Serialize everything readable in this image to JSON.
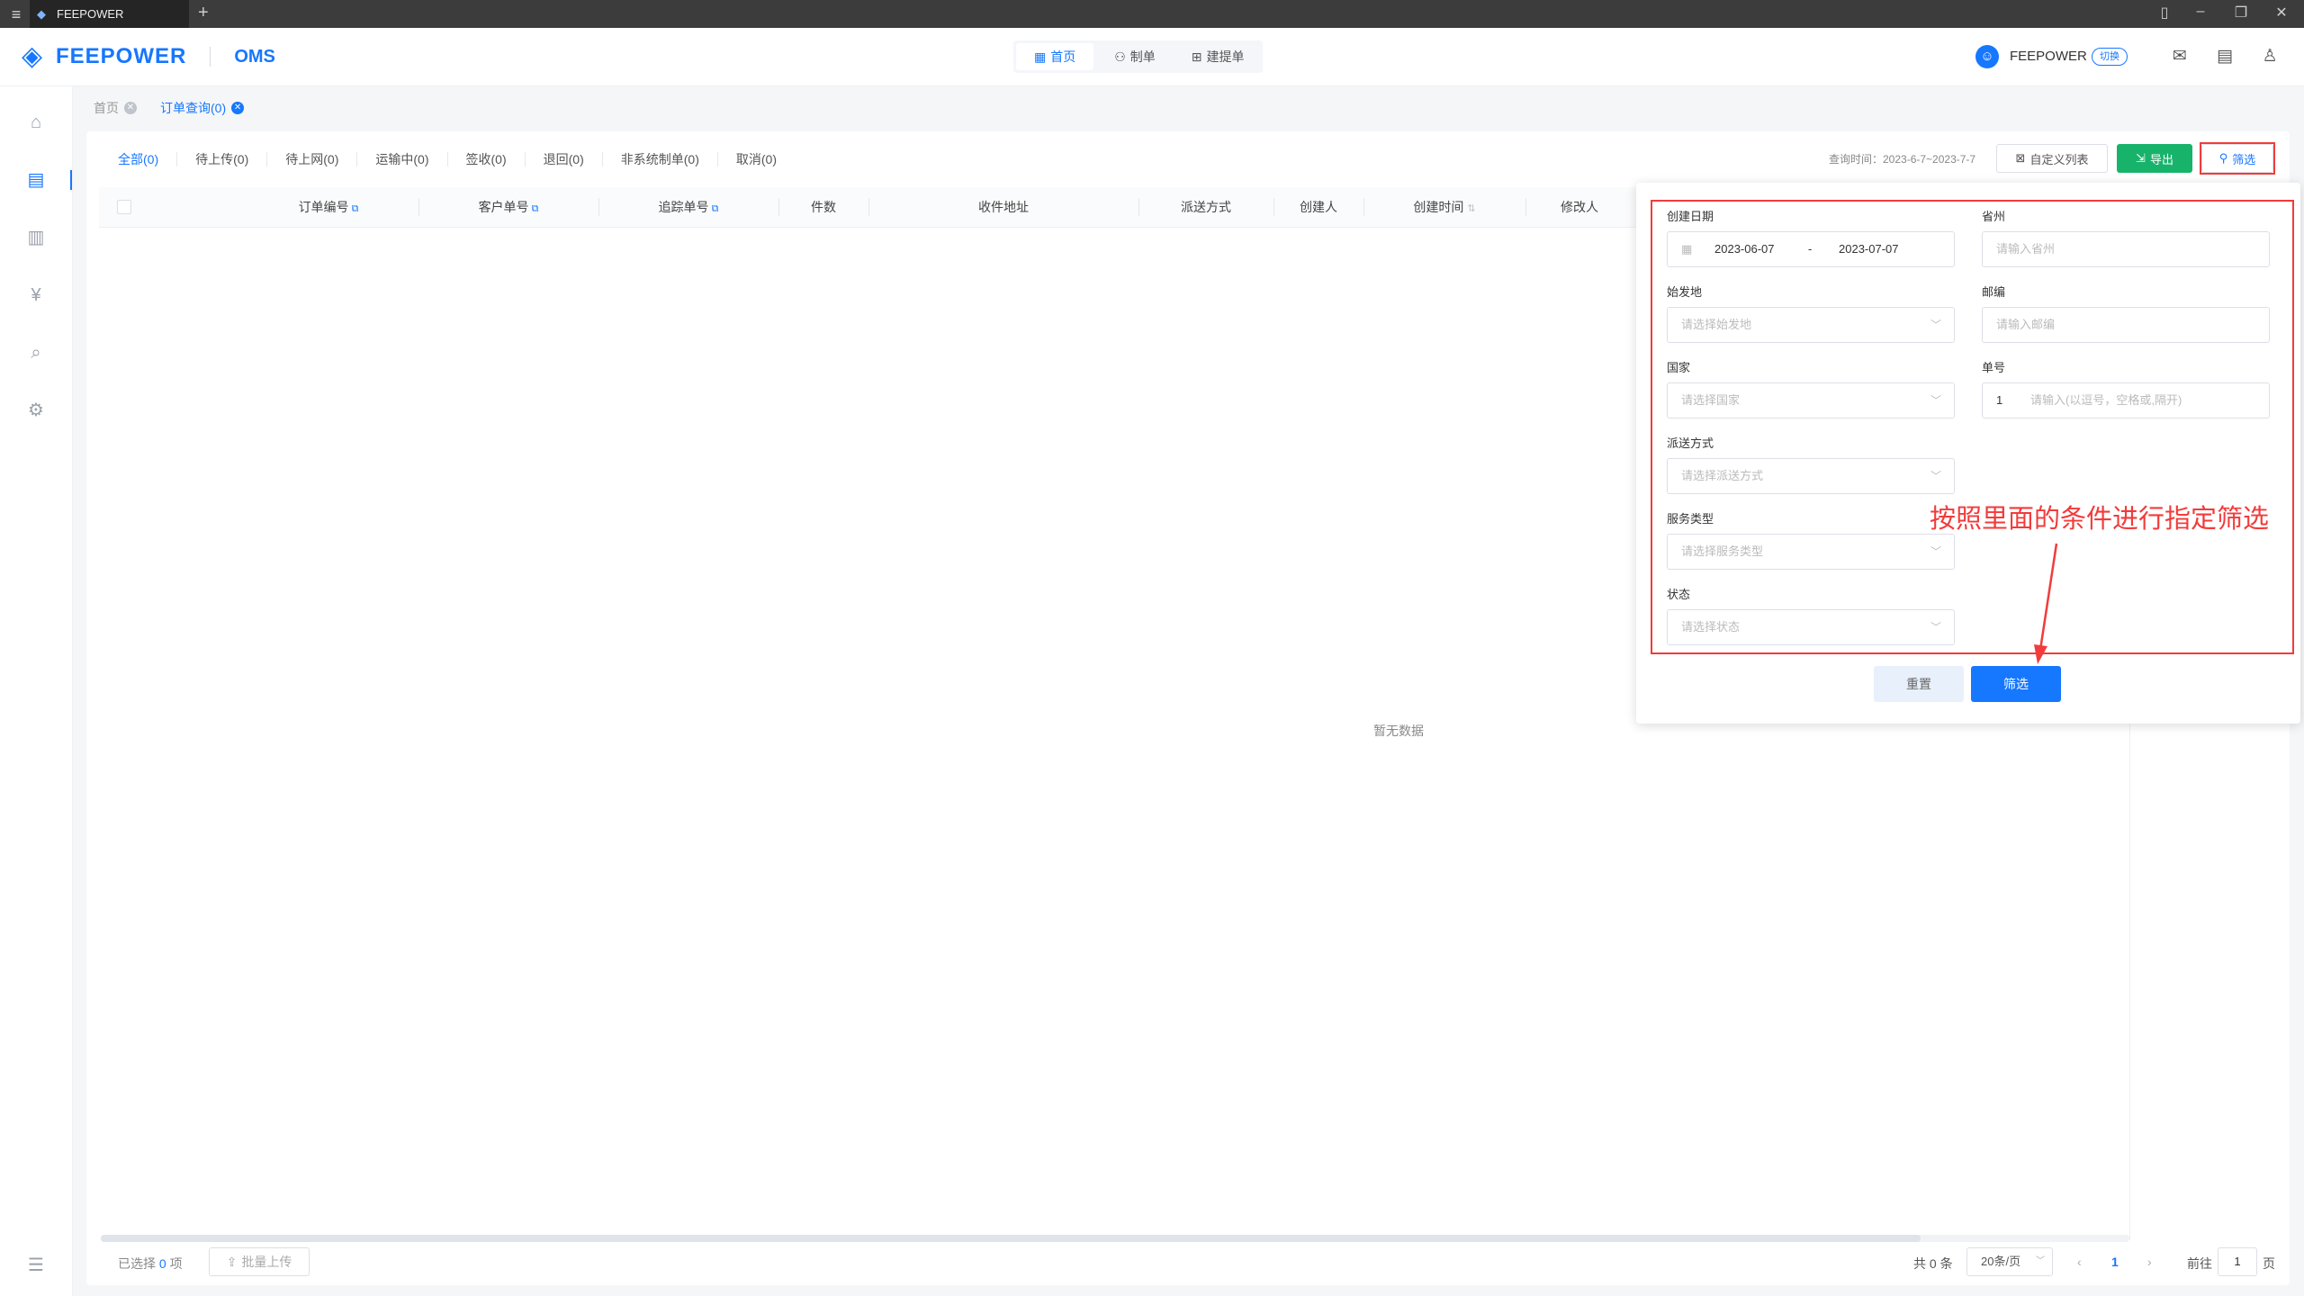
{
  "window": {
    "tab_title": "FEEPOWER"
  },
  "header": {
    "brand": "FEEPOWER",
    "product": "OMS",
    "nav": [
      "首页",
      "制单",
      "建提单"
    ],
    "user_name": "FEEPOWER",
    "switch_label": "切换"
  },
  "breadcrumb": [
    "首页",
    "订单查询(0)"
  ],
  "status_tabs": [
    "全部(0)",
    "待上传(0)",
    "待上网(0)",
    "运输中(0)",
    "签收(0)",
    "退回(0)",
    "非系统制单(0)",
    "取消(0)"
  ],
  "toolbar": {
    "query_time": "查询时间：2023-6-7~2023-7-7",
    "custom_columns": "自定义列表",
    "export": "导出",
    "filter": "筛选"
  },
  "table": {
    "columns": [
      "订单编号",
      "客户单号",
      "追踪单号",
      "件数",
      "收件地址",
      "派送方式",
      "创建人",
      "创建时间",
      "修改人"
    ],
    "empty_text": "暂无数据"
  },
  "footer": {
    "selected_prefix": "已选择",
    "selected_count": "0",
    "selected_suffix": "项",
    "batch_upload": "批量上传",
    "total": "共 0 条",
    "page_size": "20条/页",
    "current_page": "1",
    "goto_label": "前往",
    "goto_value": "1",
    "page_suffix": "页"
  },
  "filter_panel": {
    "create_date_label": "创建日期",
    "date_start": "2023-06-07",
    "date_sep": "-",
    "date_end": "2023-07-07",
    "province_label": "省州",
    "province_placeholder": "请输入省州",
    "origin_label": "始发地",
    "origin_placeholder": "请选择始发地",
    "zip_label": "邮编",
    "zip_placeholder": "请输入邮编",
    "country_label": "国家",
    "country_placeholder": "请选择国家",
    "number_label": "单号",
    "number_value": "1",
    "number_placeholder": "请输入(以逗号，空格或,隔开)",
    "delivery_label": "派送方式",
    "delivery_placeholder": "请选择派送方式",
    "service_label": "服务类型",
    "service_placeholder": "请选择服务类型",
    "status_label": "状态",
    "status_placeholder": "请选择状态",
    "reset": "重置",
    "submit": "筛选",
    "annotation": "按照里面的条件进行指定筛选"
  },
  "colors": {
    "primary": "#1677ff",
    "success": "#18b36b",
    "annotation": "#f23b3b"
  }
}
